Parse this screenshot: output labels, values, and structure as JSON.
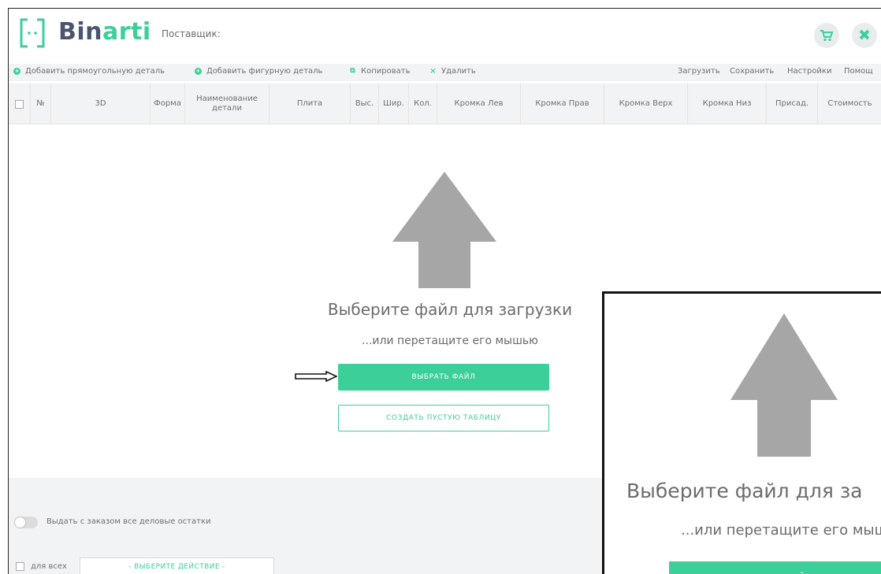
{
  "header": {
    "brand_part1": "Bin",
    "brand_part2": "arti",
    "supplier_label": "Поставщик:"
  },
  "toolbar": {
    "add_rect": "Добавить прямоугольную деталь",
    "add_shaped": "Добавить фигурную деталь",
    "copy": "Копировать",
    "delete": "Удалить",
    "load": "Загрузить",
    "save": "Сохранить",
    "settings": "Настройки",
    "help": "Помощ"
  },
  "table": {
    "columns": [
      "№",
      "3D",
      "Форма",
      "Наименование детали",
      "Плита",
      "Выс.",
      "Шир.",
      "Кол.",
      "Кромка Лев",
      "Кромка Прав",
      "Кромка Верх",
      "Кромка Низ",
      "Присад.",
      "Стоимость"
    ]
  },
  "upload": {
    "title": "Выберите файл для загрузки",
    "subtitle": "...или перетащите его мышью",
    "choose_file": "ВЫБРАТЬ ФАЙЛ",
    "create_empty": "СОЗДАТЬ ПУСТУЮ ТАБЛИЦУ"
  },
  "bottom": {
    "toggle_label": "Выдать с заказом все деловые остатки",
    "for_all_label": "для всех",
    "action_placeholder": "- ВЫБЕРИТЕ ДЕЙСТВИЕ -"
  },
  "inset": {
    "title": "Выберите файл для за",
    "subtitle": "...или перетащите его мыш",
    "button": "ВЫБРАТЬ ФАЙЛ"
  },
  "colors": {
    "accent": "#3ccf9a",
    "brand_dark": "#4a5570",
    "panel_bg": "#f2f3f4",
    "arrow_gray": "#a6a6a6"
  },
  "icons": {
    "logo": "door-logo-icon",
    "cart": "cart-icon",
    "close": "close-icon",
    "upload": "upload-arrow-icon",
    "pointer": "pointer-arrow-icon"
  }
}
